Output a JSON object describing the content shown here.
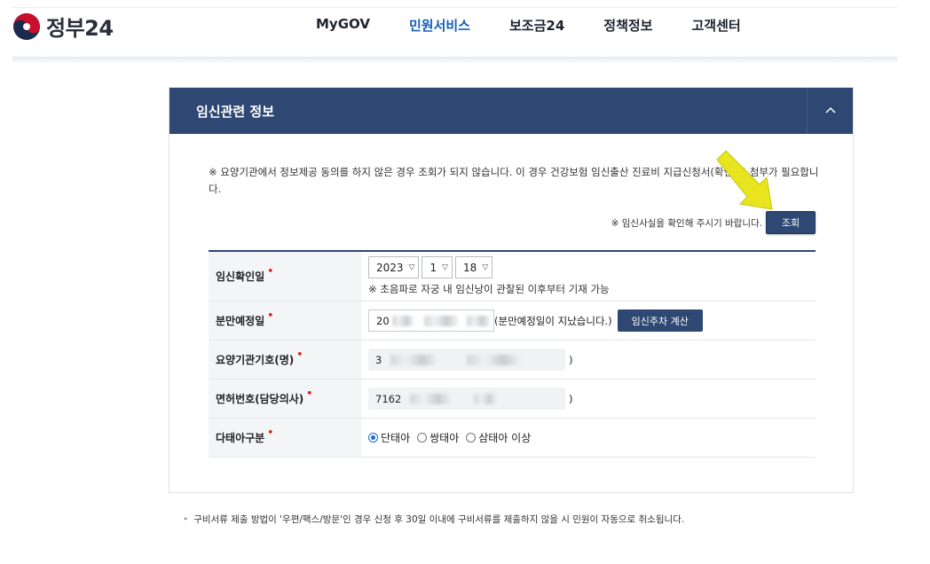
{
  "header": {
    "logo_text": "정부24",
    "nav": [
      "MyGOV",
      "민원서비스",
      "보조금24",
      "정책정보",
      "고객센터"
    ],
    "active_nav": "민원서비스"
  },
  "panel": {
    "title": "임신관련 정보",
    "notice": "※ 요양기관에서 정보제공 동의를 하지 않은 경우 조회가 되지 않습니다. 이 경우 건강보험 임신출산 진료비 지급신청서(확인서) 첨부가 필요합니다.",
    "confirm_text": "※ 임신사실을 확인해 주시기 바랍니다.",
    "query_button": "조회"
  },
  "form": {
    "pregnancy_date": {
      "label": "임신확인일",
      "year": "2023",
      "month": "1",
      "day": "18",
      "hint": "※ 초음파로 자궁 내 임신낭이 관찰된 이후부터 기재 가능"
    },
    "due_date": {
      "label": "분만예정일",
      "value_prefix": "20",
      "message": "(분만예정일이 지났습니다.)",
      "calc_button": "임신주차 계산"
    },
    "institution": {
      "label": "요양기관기호(명)",
      "value_prefix": "3",
      "suffix": ")"
    },
    "license": {
      "label": "면허번호(담당의사)",
      "value_prefix": "7162",
      "suffix": ")"
    },
    "multiple": {
      "label": "다태아구분",
      "options": [
        "단태아",
        "쌍태아",
        "삼태아 이상"
      ],
      "selected": "단태아"
    },
    "required_mark": "•"
  },
  "footnote": "구비서류 제출 방법이 '우편/팩스/방문'인 경우 신청 후 30일 이내에 구비서류를 제출하지 않을 시 민원이 자동으로 취소됩니다.",
  "colors": {
    "primary": "#2e4773",
    "active_nav": "#1560b8",
    "required": "#e0261b",
    "arrow": "#e8e51e"
  }
}
